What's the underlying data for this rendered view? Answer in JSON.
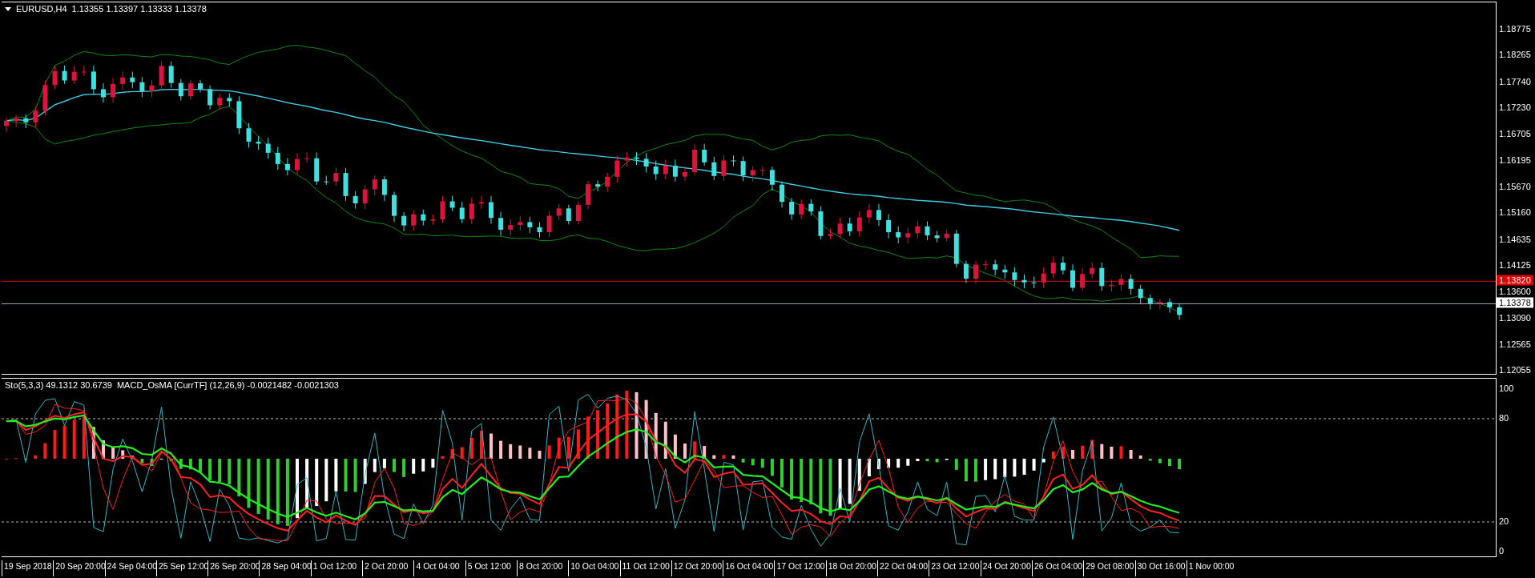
{
  "chart": {
    "symbol": "EURUSD,H4",
    "ohlc": "1.13355 1.13397 1.13333 1.13378"
  },
  "price_axis": {
    "labels": [
      "1.18775",
      "1.18265",
      "1.17740",
      "1.17230",
      "1.16705",
      "1.16195",
      "1.15670",
      "1.15160",
      "1.14635",
      "1.14125",
      "1.13600",
      "1.13090",
      "1.12565",
      "1.12055"
    ],
    "ask_line": "1.13820",
    "bid_line": "1.13378"
  },
  "indicator_window": {
    "stochastic_title": "Sto(5,3,3) 49.1312 30.6739",
    "macd_title": "MACD_OsMA [CurrTF] (12,26,9) -0.0021482 -0.0021303",
    "scale_labels": [
      "100",
      "80",
      "20",
      "0"
    ]
  },
  "time_axis": {
    "labels": [
      "19 Sep 2018",
      "20 Sep 20:00",
      "24 Sep 04:00",
      "25 Sep 12:00",
      "26 Sep 20:00",
      "28 Sep 04:00",
      "1 Oct 12:00",
      "2 Oct 20:00",
      "4 Oct 04:00",
      "5 Oct 12:00",
      "8 Oct 20:00",
      "10 Oct 04:00",
      "11 Oct 12:00",
      "12 Oct 20:00",
      "16 Oct 04:00",
      "17 Oct 12:00",
      "18 Oct 20:00",
      "22 Oct 04:00",
      "23 Oct 12:00",
      "24 Oct 20:00",
      "26 Oct 04:00",
      "29 Oct 08:00",
      "30 Oct 16:00",
      "1 Nov 00:00"
    ]
  }
}
